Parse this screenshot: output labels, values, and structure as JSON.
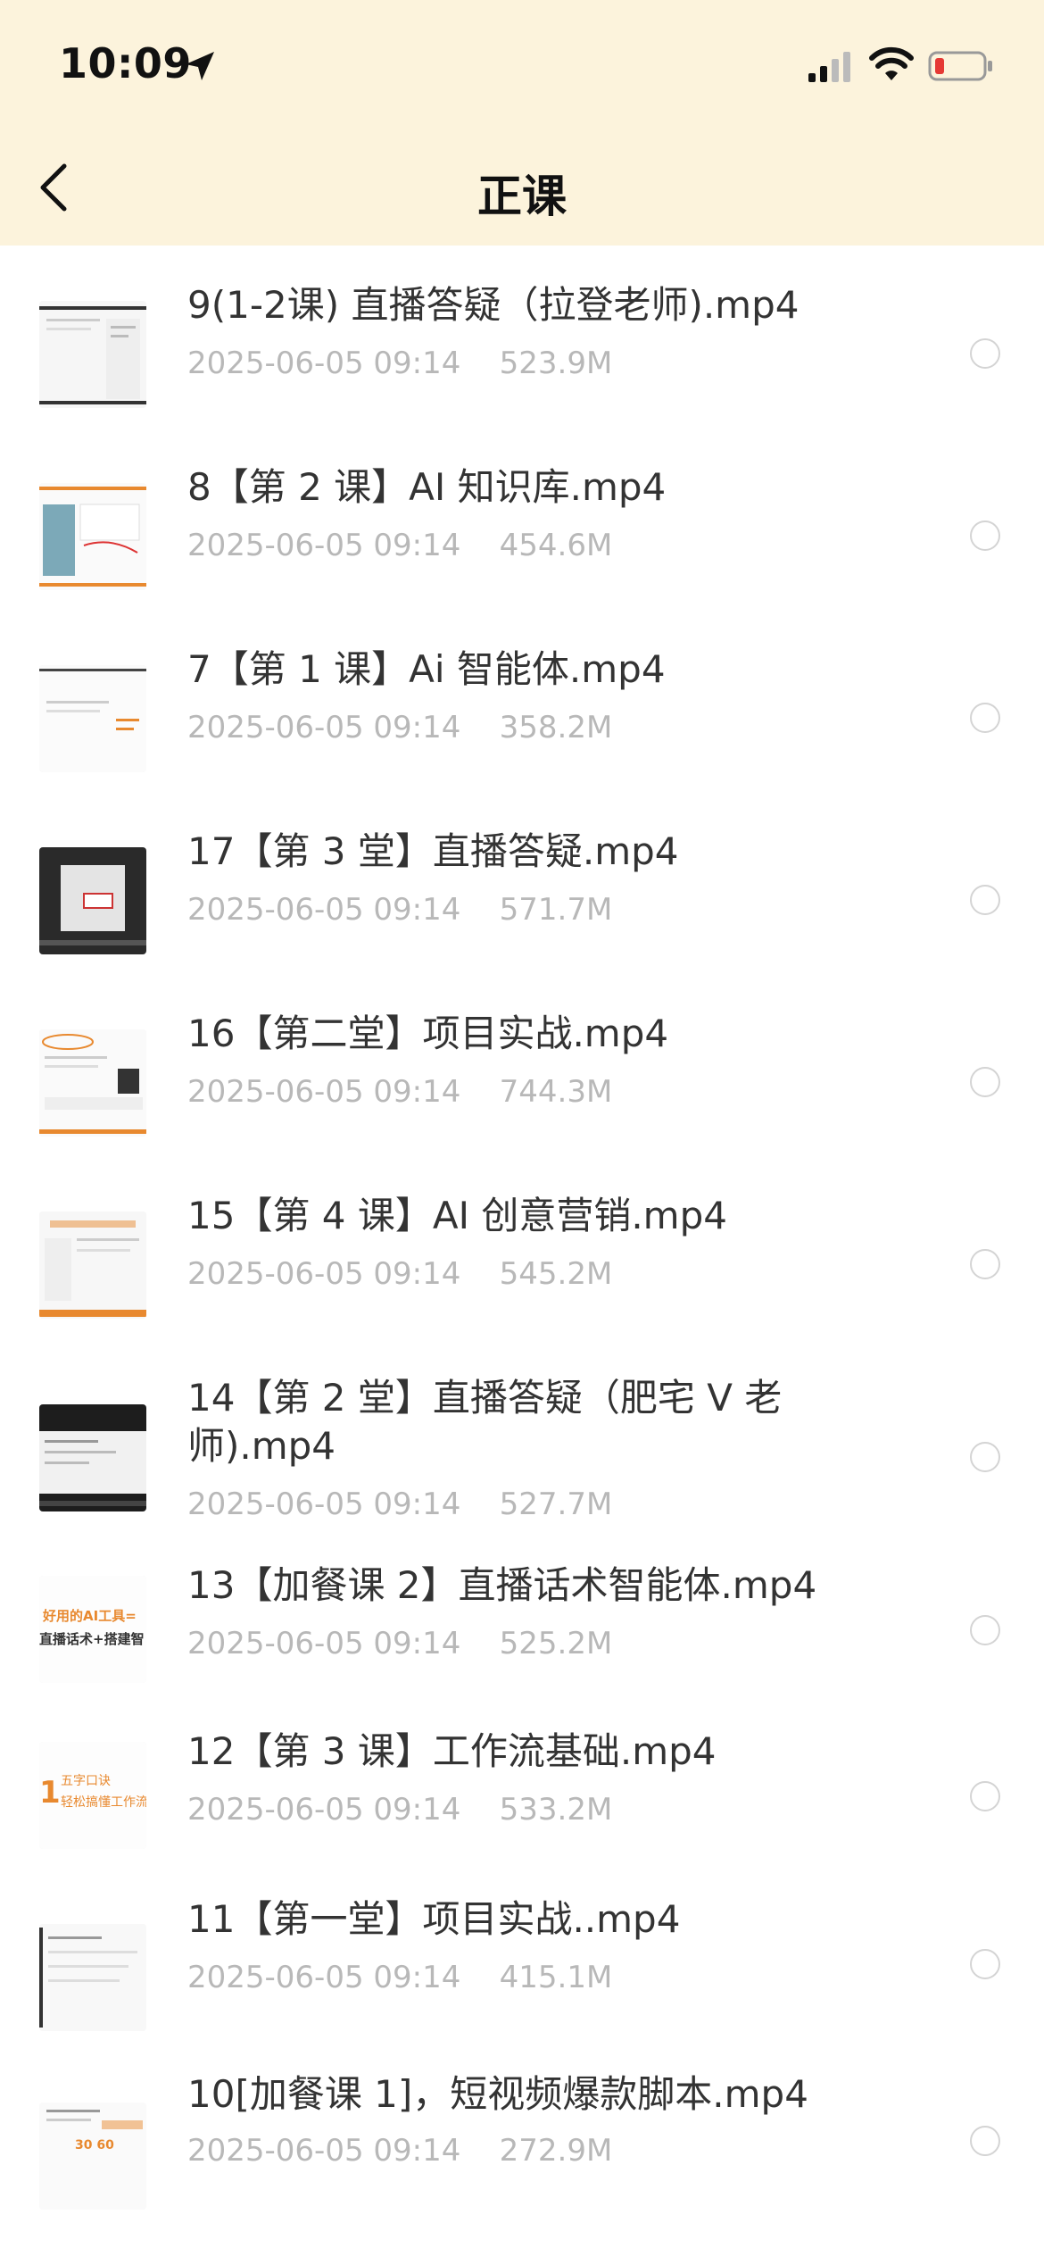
{
  "status_bar": {
    "time": "10:09"
  },
  "nav": {
    "title": "正课"
  },
  "files": [
    {
      "name": "9(1-2课) 直播答疑（拉登老师).mp4",
      "date": "2025-06-05 09:14",
      "size": "523.9M"
    },
    {
      "name": "8【第 2 课】AI 知识库.mp4",
      "date": "2025-06-05 09:14",
      "size": "454.6M"
    },
    {
      "name": "7【第 1 课】Ai 智能体.mp4",
      "date": "2025-06-05 09:14",
      "size": "358.2M"
    },
    {
      "name": "17【第 3 堂】直播答疑.mp4",
      "date": "2025-06-05 09:14",
      "size": "571.7M"
    },
    {
      "name": "16【第二堂】项目实战.mp4",
      "date": "2025-06-05 09:14",
      "size": "744.3M"
    },
    {
      "name": "15【第 4 课】AI 创意营销.mp4",
      "date": "2025-06-05 09:14",
      "size": "545.2M"
    },
    {
      "name": "14【第 2 堂】直播答疑（肥宅 V 老师).mp4",
      "date": "2025-06-05 09:14",
      "size": "527.7M"
    },
    {
      "name": "13【加餐课 2】直播话术智能体.mp4",
      "date": "2025-06-05 09:14",
      "size": "525.2M"
    },
    {
      "name": "12【第 3 课】工作流基础.mp4",
      "date": "2025-06-05 09:14",
      "size": "533.2M"
    },
    {
      "name": "11【第一堂】项目实战..mp4",
      "date": "2025-06-05 09:14",
      "size": "415.1M"
    },
    {
      "name": "10[加餐课 1]，短视频爆款脚本.mp4",
      "date": "2025-06-05 09:14",
      "size": "272.9M"
    }
  ],
  "thumb_text": {
    "t8": "好用的AI工具=",
    "t8b": "直播话术+搭建智",
    "t9a": "五字口诀",
    "t9b": "轻松搞懂工作流",
    "t11": "30  60"
  },
  "colors": {
    "header_bg": "#fcf3dc",
    "accent_orange": "#e8892f",
    "meta_gray": "#b8b8b8"
  }
}
